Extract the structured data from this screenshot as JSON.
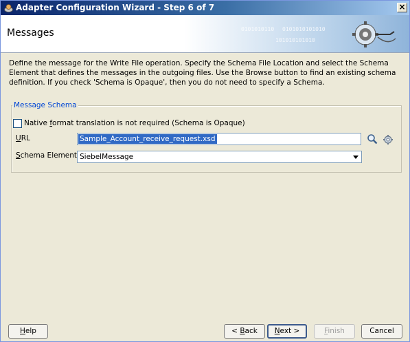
{
  "window": {
    "title": "Adapter Configuration Wizard - Step 6 of 7",
    "close_label": "×"
  },
  "header": {
    "title": "Messages",
    "binary_1": "0101010110",
    "binary_2": "0101010101010",
    "binary_3": "101010101010"
  },
  "description": "Define the message for the Write File operation.  Specify the Schema File Location and select the Schema Element that defines the messages in the outgoing files. Use the Browse button to find an existing schema definition. If you check 'Schema is Opaque', then you do not need to specify a Schema.",
  "message_schema": {
    "group_label": "Message Schema",
    "checkbox_label": "Native format translation is not required (Schema is Opaque)",
    "checkbox_checked": false,
    "url_label": "URL",
    "url_value": "Sample_Account_receive_request.xsd",
    "schema_element_label": "Schema Element",
    "schema_element_value": "SiebelMessage"
  },
  "buttons": {
    "help": "Help",
    "back": "< Back",
    "next": "Next >",
    "finish": "Finish",
    "cancel": "Cancel"
  },
  "icons": {
    "title": "wizard-icon",
    "search": "search-icon",
    "settings": "gear-icon",
    "dropdown": "chevron-down-icon"
  }
}
